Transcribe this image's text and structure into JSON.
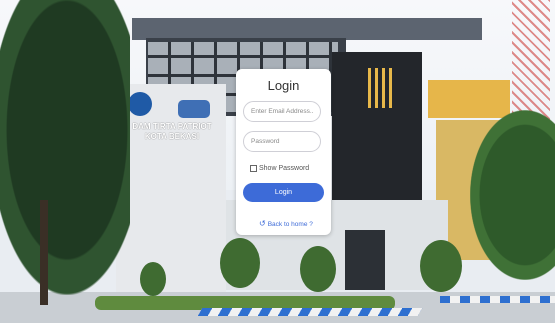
{
  "background": {
    "sign_text": "DAM TIRTA PATRIOT\nKOTA BEKASI"
  },
  "login": {
    "title": "Login",
    "email_placeholder": "Enter Email Address...",
    "password_placeholder": "Password",
    "show_password_label": "Show Password",
    "login_button": "Login",
    "back_link": "Back to home ?",
    "back_icon": "undo-arrow-icon",
    "accent_color": "#3d6bd8"
  }
}
